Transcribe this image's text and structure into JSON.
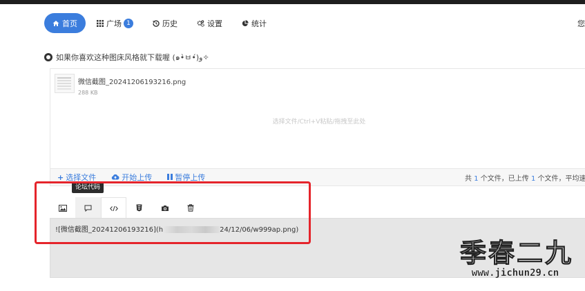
{
  "nav": {
    "items": [
      {
        "label": "首页",
        "icon": "home-icon",
        "active": true
      },
      {
        "label": "广场",
        "icon": "grid-icon",
        "badge": "1"
      },
      {
        "label": "历史",
        "icon": "history-icon"
      },
      {
        "label": "设置",
        "icon": "gear-icon"
      },
      {
        "label": "统计",
        "icon": "pie-chart-icon"
      }
    ],
    "right_text": "您"
  },
  "promo": {
    "text": "如果你喜欢这种图床风格就下载喔 (๑•̀ㅂ•́)و✧"
  },
  "upload": {
    "file_name": "微信截图_20241206193216.png",
    "file_size": "288 KB",
    "drop_hint": "选择文件/Ctrl+V粘贴/拖拽至此处"
  },
  "actions": {
    "choose": "选择文件",
    "start": "开始上传",
    "pause": "暂停上传"
  },
  "status": {
    "prefix": "共",
    "total": "1",
    "mid": "个文件，已上传",
    "uploaded": "1",
    "suffix": "个文件，平均速"
  },
  "tooltip": "论坛代码",
  "format_tabs": [
    {
      "icon": "image-icon"
    },
    {
      "icon": "comment-icon"
    },
    {
      "icon": "code-icon"
    },
    {
      "icon": "html5-icon"
    },
    {
      "icon": "camera-icon"
    },
    {
      "icon": "trash-icon"
    }
  ],
  "output": {
    "text_before": "![微信截图_20241206193216](h",
    "text_after": "24/12/06/w999ap.png)"
  },
  "watermark": {
    "cn": "季春二九",
    "url": "www.jichun29.cn"
  },
  "colors": {
    "accent": "#3b7ddd",
    "annotation": "#e5242b"
  }
}
